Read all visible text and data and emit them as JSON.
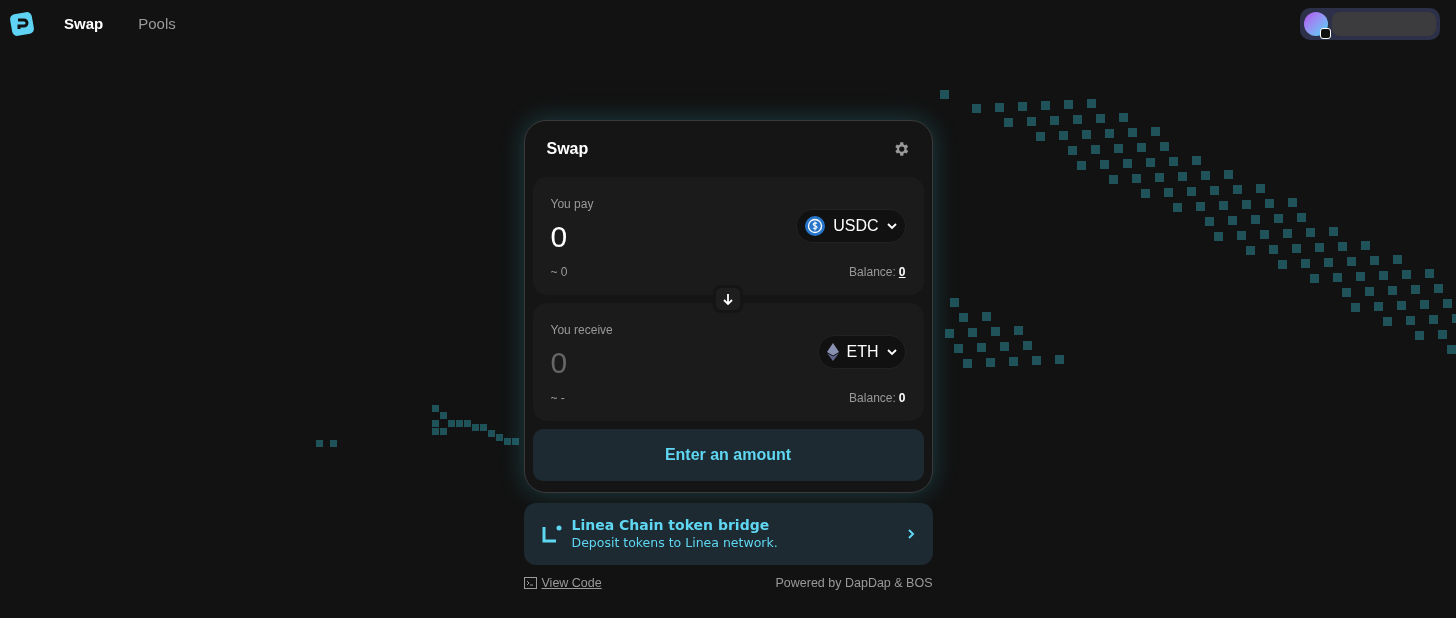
{
  "nav": {
    "tabs": [
      {
        "label": "Swap",
        "selected": true
      },
      {
        "label": "Pools",
        "selected": false
      }
    ]
  },
  "swap": {
    "title": "Swap",
    "pay": {
      "label": "You pay",
      "amount": "0",
      "usd": "~ 0",
      "token": "USDC",
      "balance_label": "Balance:",
      "balance": "0",
      "active": true
    },
    "receive": {
      "label": "You receive",
      "amount": "0",
      "usd": "~ -",
      "token": "ETH",
      "balance_label": "Balance:",
      "balance": "0",
      "active": false
    },
    "button": "Enter an amount"
  },
  "bridge": {
    "title": "Linea Chain token bridge",
    "subtitle": "Deposit tokens to Linea network."
  },
  "footer": {
    "view_code": "View Code",
    "powered_by": "Powered by DapDap & BOS"
  }
}
